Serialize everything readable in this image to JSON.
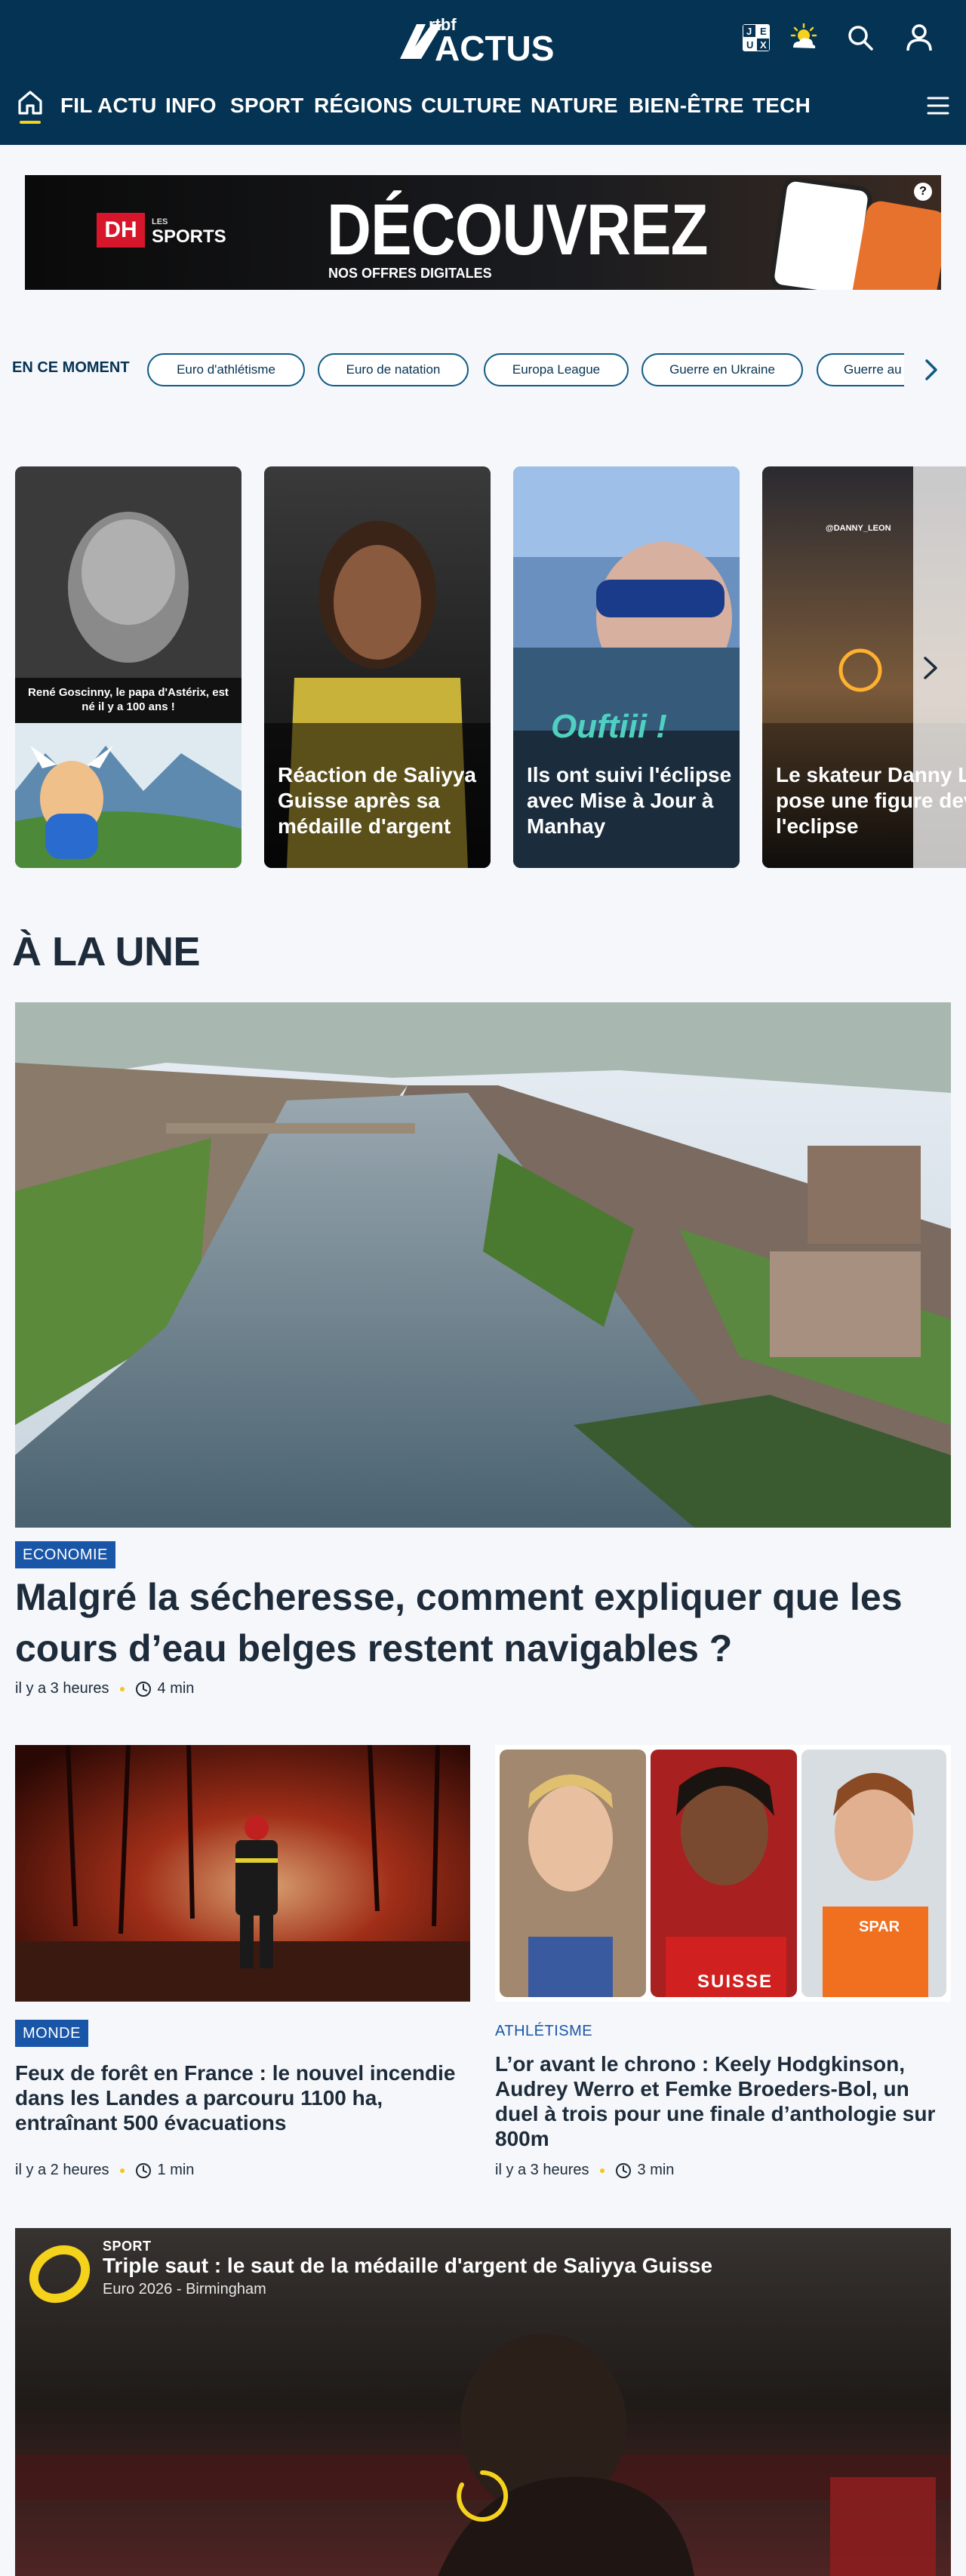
{
  "header": {
    "logo_small": "rtbf",
    "logo_big": "ACTUS",
    "icons": [
      "games-icon",
      "weather-icon",
      "search-icon",
      "user-icon"
    ],
    "games_letters": [
      "J",
      "E",
      "U",
      "X"
    ]
  },
  "nav": {
    "items": [
      "FIL ACTU",
      "INFO",
      "SPORT",
      "RÉGIONS",
      "CULTURE",
      "NATURE",
      "BIEN-ÊTRE",
      "TECH"
    ]
  },
  "ad": {
    "brand_dh": "DH",
    "brand_les": "LES",
    "brand_sports": "SPORTS",
    "headline": "DÉCOUVREZ",
    "subline": "NOS OFFRES DIGITALES",
    "info": "?"
  },
  "trending": {
    "label": "EN CE MOMENT",
    "chips": [
      "Euro d'athlétisme",
      "Euro de natation",
      "Europa League",
      "Guerre en Ukraine",
      "Guerre au"
    ]
  },
  "stories": [
    {
      "caption": "",
      "inner_text": "René Goscinny, le papa d'Astérix, est né il y a 100 ans !"
    },
    {
      "caption": "Réaction de Saliyya Guisse après sa médaille d'argent",
      "inner_text": ""
    },
    {
      "caption": "Ils ont suivi l'éclipse avec Mise à Jour à Manhay",
      "inner_text": "Ouftiii !"
    },
    {
      "caption": "Le skateur Danny León pose une figure devant l'eclipse",
      "inner_text": "@DANNY_LEON"
    }
  ],
  "headline": {
    "section": "À LA UNE",
    "tag": "ECONOMIE",
    "title": "Malgré la sécheresse, comment expliquer que les cours d’eau belges restent navigables ?",
    "time": "il y a 3 heures",
    "read": "4 min"
  },
  "cards": [
    {
      "tag": "MONDE",
      "title": "Feux de forêt en France : le nouvel incendie dans les Landes a parcouru 1100 ha, entraînant 500 évacuations",
      "time": "il y a 2 heures",
      "read": "1 min"
    },
    {
      "tag": "ATHLÉTISME",
      "title": "L’or avant le chrono : Keely Hodgkinson, Audrey Werro et Femke Broeders-Bol, un duel à trois pour une finale d’anthologie sur 800m",
      "time": "il y a 3 heures",
      "read": "3 min",
      "jersey_text": "SUISSE",
      "jersey_text2": "SPAR"
    }
  ],
  "video": {
    "category": "SPORT",
    "title": "Triple saut : le saut de la médaille d'argent de Saliyya Guisse",
    "subtitle": "Euro 2026 - Birmingham"
  },
  "colors": {
    "header_bg": "#053353",
    "accent_yellow": "#f5d21c",
    "tag_blue": "#1a56a8",
    "text_dark": "#1d2b3a"
  }
}
